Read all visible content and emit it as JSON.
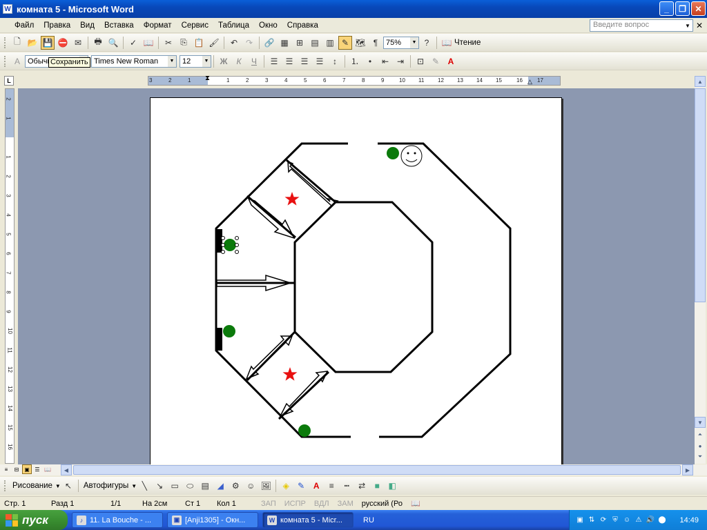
{
  "window": {
    "title": "комната 5 - Microsoft Word",
    "icon_letter": "W"
  },
  "menu": [
    "Файл",
    "Правка",
    "Вид",
    "Вставка",
    "Формат",
    "Сервис",
    "Таблица",
    "Окно",
    "Справка"
  ],
  "ask": {
    "placeholder": "Введите вопрос"
  },
  "toolbar1": {
    "zoom": "75%",
    "reading_label": "Чтение"
  },
  "toolbar2": {
    "style": "Обычн",
    "font": "Times New Roman",
    "size": "12"
  },
  "tooltip": "Сохранить",
  "ruler": {
    "h_numbers": [
      "3",
      "2",
      "1",
      "1",
      "2",
      "3",
      "4",
      "5",
      "6",
      "7",
      "8",
      "9",
      "10",
      "11",
      "12",
      "13",
      "14",
      "15",
      "16",
      "17"
    ],
    "v_numbers": [
      "2",
      "1",
      "1",
      "2",
      "3",
      "4",
      "5",
      "6",
      "7",
      "8",
      "9",
      "10",
      "11",
      "12",
      "13",
      "14",
      "15",
      "16"
    ]
  },
  "drawing": {
    "draw_label": "Рисование",
    "autoshapes_label": "Автофигуры"
  },
  "status": {
    "page": "Стр. 1",
    "section": "Разд 1",
    "pages": "1/1",
    "at": "На 2см",
    "line": "Ст 1",
    "col": "Кол 1",
    "rec": "ЗАП",
    "trk": "ИСПР",
    "ext": "ВДЛ",
    "ovr": "ЗАМ",
    "language": "русский (Ро"
  },
  "taskbar": {
    "start": "пуск",
    "tasks": [
      "11. La Bouche - ...",
      "[Anji1305] - Окн...",
      "комната 5 - Micr..."
    ],
    "lang": "RU",
    "clock": "14:49"
  },
  "colors": {
    "star": "#e81010",
    "dot": "#0b7a0b",
    "title_bar": "#0848b9"
  }
}
